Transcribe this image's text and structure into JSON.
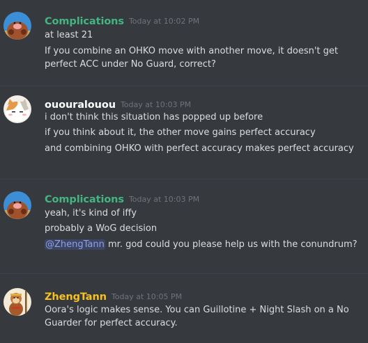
{
  "colors": {
    "background": "#36393e",
    "text": "#dcddde",
    "timestamp": "#70737a",
    "user_green": "#43b581",
    "user_white": "#ffffff",
    "user_gold": "#f7c11e",
    "mention_bg": "#3d4565",
    "mention_text": "#8ea1e1"
  },
  "messages": [
    {
      "username": "Complications",
      "timestamp": "Today at 10:02 PM",
      "avatar": "mole-avatar",
      "lines": [
        "at least 21",
        "If you combine an OHKO move with another move, it doesn't get perfect ACC under No Guard, correct?"
      ]
    },
    {
      "username": "ououralouou",
      "timestamp": "Today at 10:03 PM",
      "avatar": "cat-avatar",
      "lines": [
        "i don't think this situation has popped up before",
        "if you think about it, the other move gains perfect accuracy",
        "and combining OHKO with perfect accuracy makes perfect accuracy"
      ]
    },
    {
      "username": "Complications",
      "timestamp": "Today at 10:03 PM",
      "avatar": "mole-avatar",
      "lines": [
        "yeah, it's kind of iffy",
        "probably a WoG decision"
      ],
      "mention": "@ZhengTann",
      "mention_rest": "mr. god could you please help us with the conundrum?"
    },
    {
      "username": "ZhengTann",
      "timestamp": "Today at 10:05 PM",
      "avatar": "monkey-avatar",
      "lines": [
        "Oora's logic makes sense. You can Guillotine + Night Slash on a No Guarder for perfect accuracy."
      ]
    }
  ]
}
